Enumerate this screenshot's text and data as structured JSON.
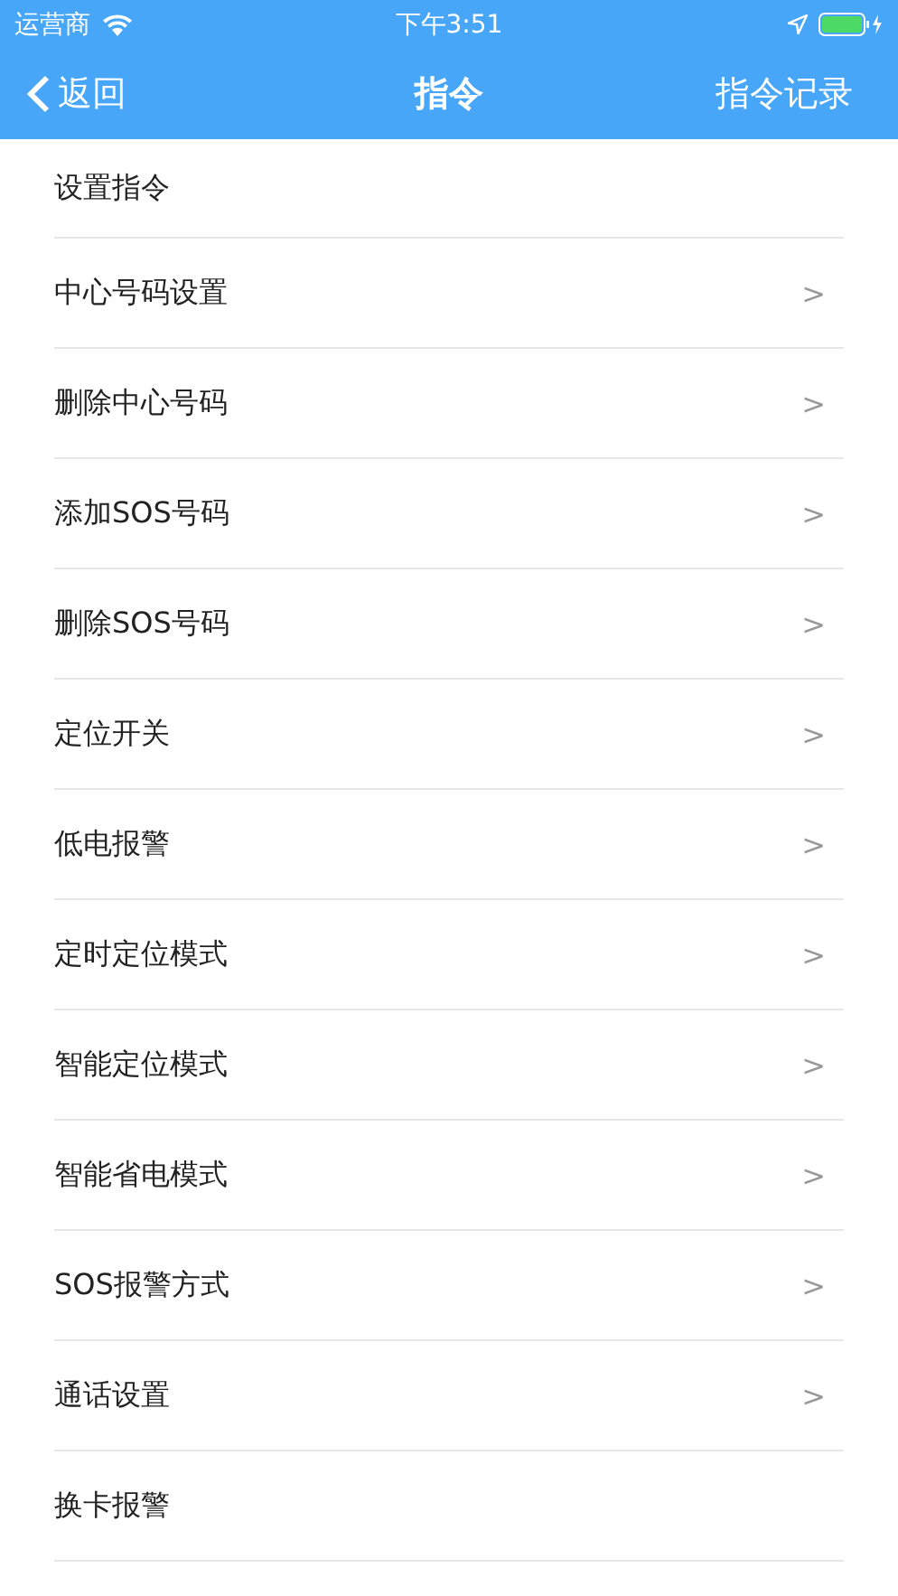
{
  "status_bar": {
    "carrier": "运营商",
    "time": "下午3:51"
  },
  "nav": {
    "back": "返回",
    "title": "指令",
    "action": "指令记录"
  },
  "items": [
    {
      "kind": "header",
      "label": "设置指令"
    },
    {
      "kind": "item",
      "label": "中心号码设置",
      "arrow": ">"
    },
    {
      "kind": "item",
      "label": "删除中心号码",
      "arrow": ">"
    },
    {
      "kind": "item",
      "label": "添加SOS号码",
      "arrow": ">"
    },
    {
      "kind": "item",
      "label": "删除SOS号码",
      "arrow": ">"
    },
    {
      "kind": "item",
      "label": "定位开关",
      "arrow": ">"
    },
    {
      "kind": "item",
      "label": "低电报警",
      "arrow": ">"
    },
    {
      "kind": "item",
      "label": "定时定位模式",
      "arrow": ">"
    },
    {
      "kind": "item",
      "label": "智能定位模式",
      "arrow": ">"
    },
    {
      "kind": "item",
      "label": "智能省电模式",
      "arrow": ">"
    },
    {
      "kind": "item",
      "label": "SOS报警方式",
      "arrow": ">"
    },
    {
      "kind": "item",
      "label": "通话设置",
      "arrow": ">"
    },
    {
      "kind": "item",
      "label": "换卡报警"
    }
  ]
}
